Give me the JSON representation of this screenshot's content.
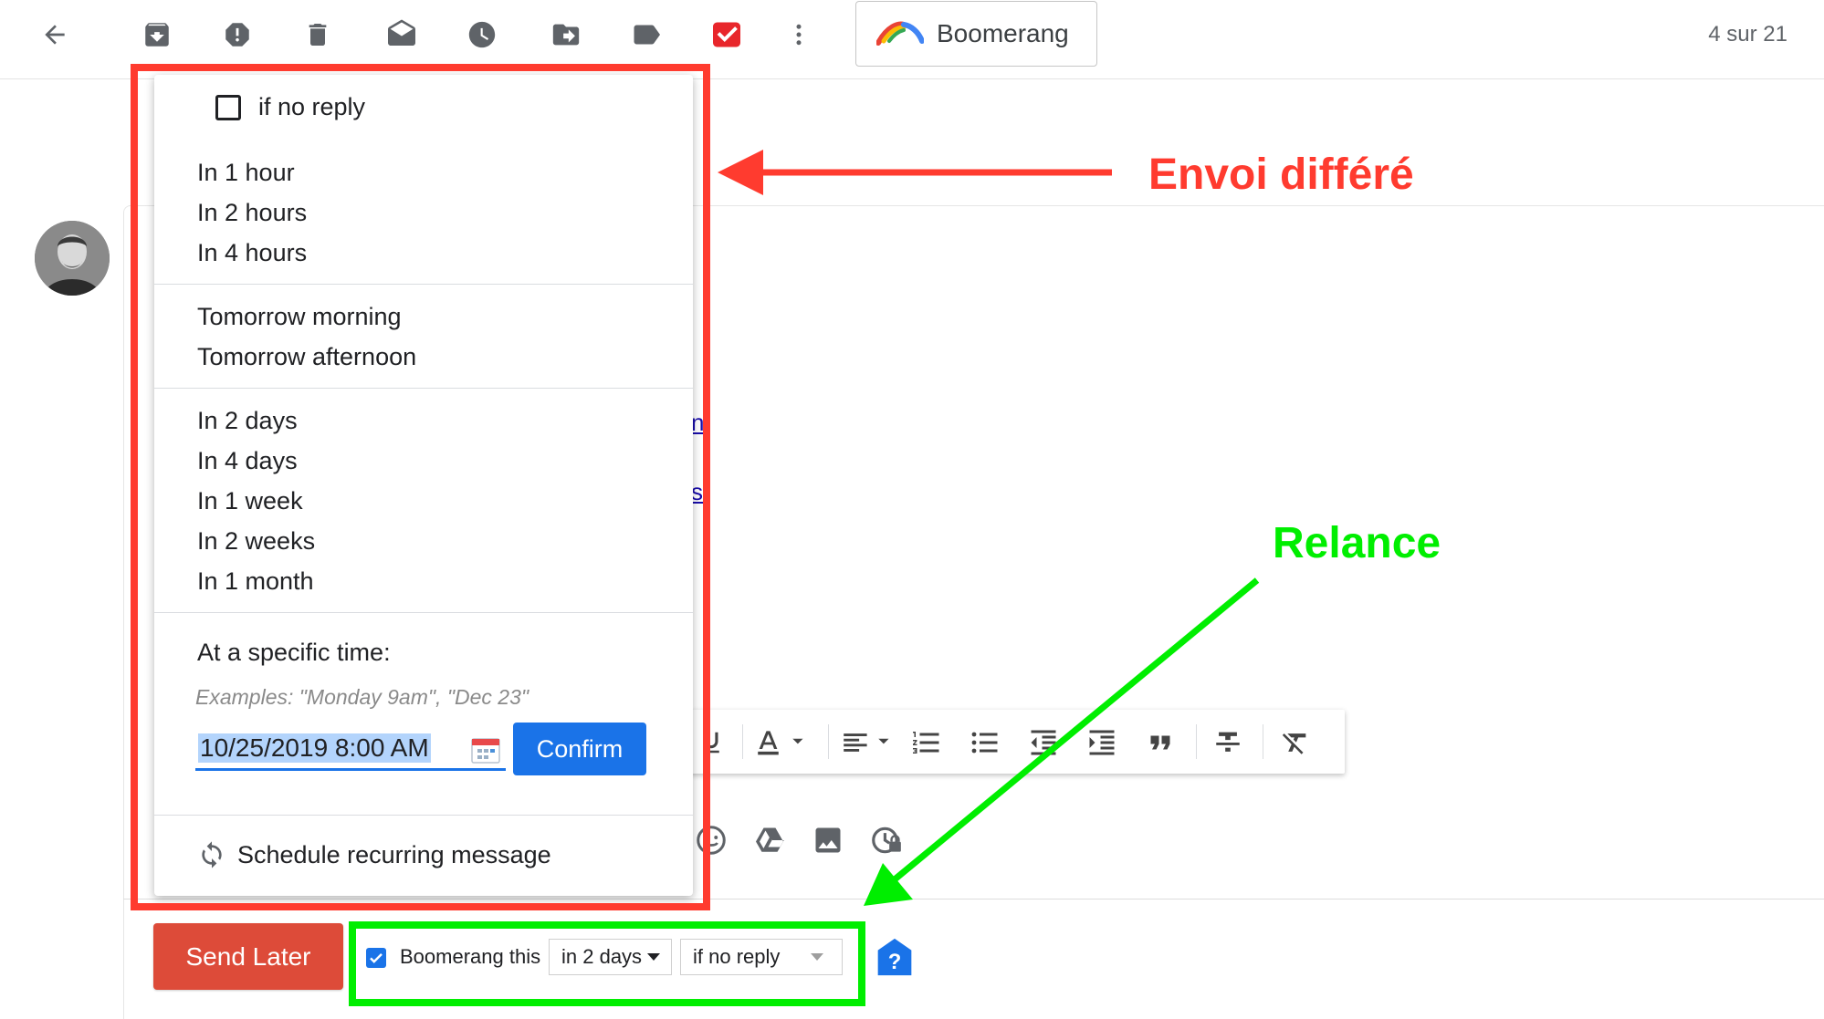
{
  "toolbar": {
    "back_icon": "arrow-left-icon",
    "icons": [
      "archive-icon",
      "report-spam-icon",
      "trash-icon",
      "mark-read-icon",
      "snooze-icon",
      "move-to-icon",
      "label-icon",
      "todo-check-icon",
      "more-vert-icon"
    ],
    "boomerang_label": "Boomerang",
    "counter": "4 sur 21"
  },
  "menu": {
    "if_no_reply": "if no reply",
    "group1": [
      "In 1 hour",
      "In 2 hours",
      "In 4 hours"
    ],
    "group2": [
      "Tomorrow morning",
      "Tomorrow afternoon"
    ],
    "group3": [
      "In 2 days",
      "In 4 days",
      "In 1 week",
      "In 2 weeks",
      "In 1 month"
    ],
    "specific_time_label": "At a specific time:",
    "examples": "Examples: \"Monday 9am\", \"Dec 23\"",
    "date_value": "10/25/2019 8:00 AM",
    "confirm_label": "Confirm",
    "recurring_label": "Schedule recurring message"
  },
  "compose": {
    "link_fragments": [
      "n",
      "s"
    ]
  },
  "bottom_bar": {
    "send_later_label": "Send Later",
    "boomerang_this_label": "Boomerang this",
    "boomerang_this_checked": true,
    "delay_value": "in 2 days",
    "condition_value": "if no reply"
  },
  "annotations": {
    "top_label": "Envoi différé",
    "bottom_label": "Relance",
    "top_color": "#ff3b2f",
    "bottom_color": "#00ee00"
  }
}
